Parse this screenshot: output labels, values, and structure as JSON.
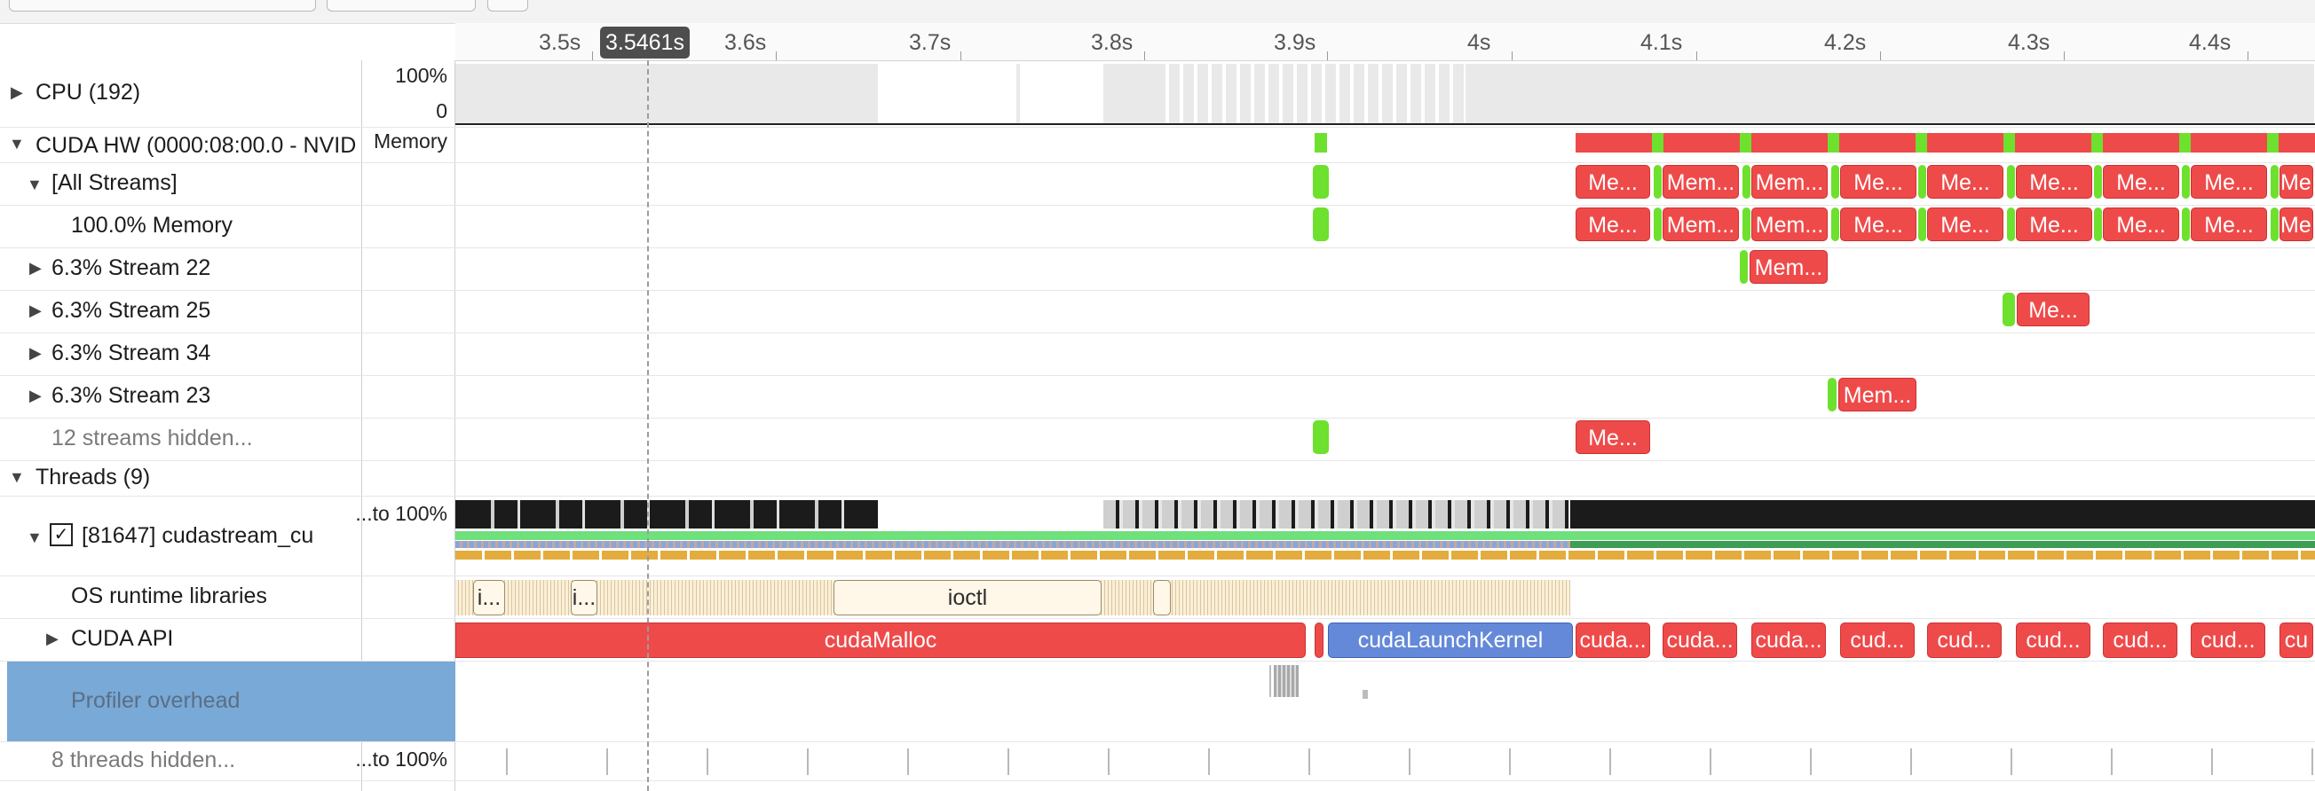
{
  "ruler": {
    "ticks": [
      "3.5s",
      "3.6s",
      "3.7s",
      "3.8s",
      "3.9s",
      "4s",
      "4.1s",
      "4.2s",
      "4.3s",
      "4.4s"
    ],
    "cursor": "3.5461s"
  },
  "rows": {
    "cpu": {
      "label": "CPU (192)",
      "scale_top": "100%",
      "scale_bottom": "0"
    },
    "cuda_hw": {
      "label": "CUDA HW (0000:08:00.0 - NVIDI",
      "sub": "Memory"
    },
    "all_streams": {
      "label": "[All Streams]"
    },
    "memory": {
      "label": "100.0% Memory"
    },
    "stream22": {
      "label": "6.3% Stream 22"
    },
    "stream25": {
      "label": "6.3% Stream 25"
    },
    "stream34": {
      "label": "6.3% Stream 34"
    },
    "stream23": {
      "label": "6.3% Stream 23"
    },
    "streams_hidden": {
      "label": "12 streams hidden..."
    },
    "threads": {
      "label": "Threads (9)"
    },
    "thread81647": {
      "label": "[81647] cudastream_cu",
      "sub": "...to 100%",
      "checked": "✓"
    },
    "os_runtime": {
      "label": "OS runtime libraries"
    },
    "cuda_api": {
      "label": "CUDA API"
    },
    "profiler": {
      "label": "Profiler overhead"
    },
    "threads_hidden": {
      "label": "8 threads hidden...",
      "sub": "...to 100%"
    }
  },
  "blocks": {
    "mem_short": "Me...",
    "mem_long": "Mem...",
    "ioctl": "ioctl",
    "i_short": "i...",
    "cudaMalloc": "cudaMalloc",
    "cudaLaunchKernel": "cudaLaunchKernel",
    "cuda_short": "cuda...",
    "cud_short": "cud...",
    "cu_short": "cu"
  },
  "colors": {
    "memcpy": "#ef4a4a",
    "kernel": "#6ee02e",
    "launch": "#6489d8",
    "selected": "#79a9d6"
  }
}
